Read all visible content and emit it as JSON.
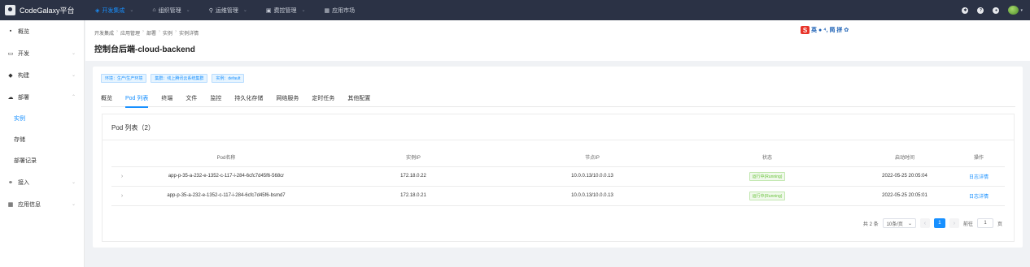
{
  "app": {
    "title": "CodeGalaxy平台"
  },
  "topnav": [
    {
      "icon": "cube-icon",
      "glyph": "◈",
      "label": "开发集成",
      "active": true
    },
    {
      "icon": "org-icon",
      "glyph": "⌂",
      "label": "组织管理"
    },
    {
      "icon": "ops-icon",
      "glyph": "⚲",
      "label": "运维管理"
    },
    {
      "icon": "billing-icon",
      "glyph": "▣",
      "label": "费控管理"
    },
    {
      "icon": "market-icon",
      "glyph": "▦",
      "label": "应用市场"
    }
  ],
  "sidebar": {
    "items": [
      {
        "label": "概览",
        "glyph": "▪"
      },
      {
        "label": "开发",
        "glyph": "▭"
      },
      {
        "label": "构建",
        "glyph": "◆"
      },
      {
        "label": "部署",
        "glyph": "☁"
      },
      {
        "label": "接入",
        "glyph": "⚭"
      },
      {
        "label": "应用信息",
        "glyph": "▦"
      }
    ],
    "sub_items": [
      "实例",
      "存储",
      "部署记录"
    ]
  },
  "breadcrumb": [
    "开发集成",
    "应用管理",
    "部署",
    "实例",
    "实例详情"
  ],
  "page": {
    "title": "控制台后端-cloud-backend"
  },
  "ime": {
    "label": "英 ● ⁴, 简 拼 ✿"
  },
  "tags": [
    "环境：生产/生产环境",
    "集群：线上腾讯云系统集群",
    "实例：default"
  ],
  "tabs": [
    "概览",
    "Pod 列表",
    "终端",
    "文件",
    "监控",
    "持久化存储",
    "网络服务",
    "定时任务",
    "其他配置"
  ],
  "pod_panel": {
    "title": "Pod 列表（2）",
    "columns": [
      "Pod名称",
      "实例IP",
      "节点IP",
      "状态",
      "启动时间",
      "操作"
    ],
    "rows": [
      {
        "name": "app-p-35-a-232-e-1352-c-117-i-284-6cfc7d45f6-568cr",
        "pod_ip": "172.18.0.22",
        "node_ip": "10.0.0.13/10.0.0.13",
        "status": "运行中(Running)",
        "start_time": "2022-05-25 20:05:04",
        "action": "日志详情"
      },
      {
        "name": "app-p-35-a-232-e-1352-c-117-i-284-6cfc7d45f6-bsmd7",
        "pod_ip": "172.18.0.21",
        "node_ip": "10.0.0.13/10.0.0.13",
        "status": "运行中(Running)",
        "start_time": "2022-05-25 20:05:01",
        "action": "日志详情"
      }
    ]
  },
  "pagination": {
    "total": "共 2 条",
    "page_size": "10条/页",
    "current": "1",
    "goto_label": "前往",
    "goto_value": "1",
    "page_suffix": "页"
  },
  "colors": {
    "accent": "#1890ff",
    "topbar": "#2b3245",
    "running": "#67c23a"
  }
}
